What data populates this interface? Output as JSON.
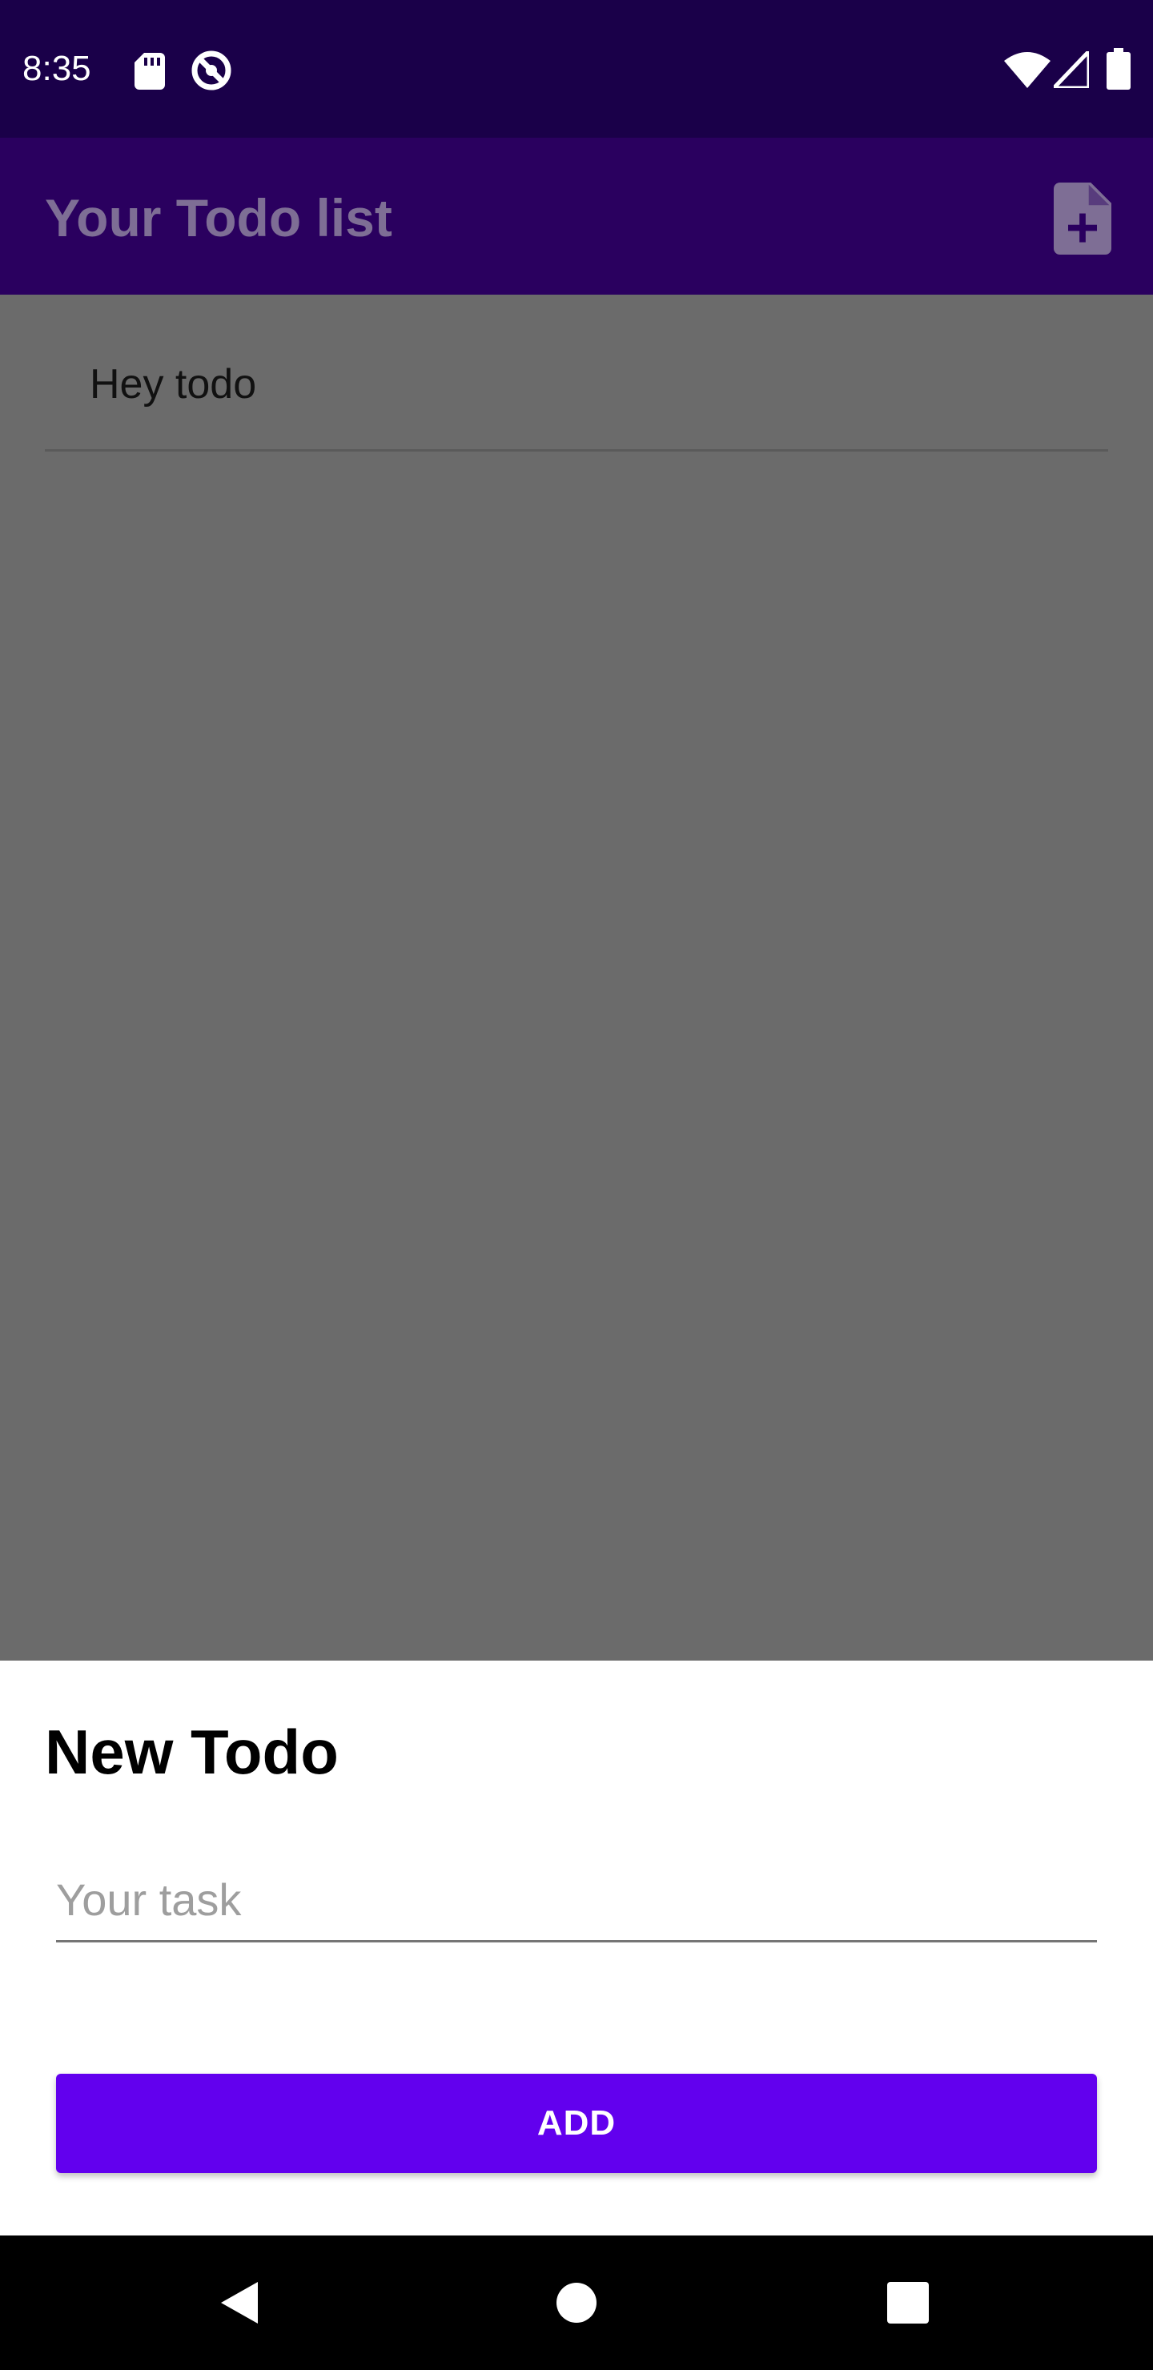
{
  "status_bar": {
    "time": "8:35",
    "icons": [
      "sd-card-icon",
      "do-not-disturb-icon",
      "wifi-icon",
      "signal-icon",
      "battery-icon"
    ]
  },
  "app_bar": {
    "title": "Your Todo list",
    "action_icon": "note-add-icon"
  },
  "todo_list": {
    "items": [
      {
        "label": "Hey todo"
      }
    ]
  },
  "sheet": {
    "title": "New Todo",
    "input_placeholder": "Your task",
    "input_value": "",
    "add_label": "ADD"
  },
  "nav_bar": {
    "buttons": [
      "back-icon",
      "home-icon",
      "recents-icon"
    ]
  },
  "colors": {
    "status_bar": "#1a0049",
    "app_bar": "#2a005f",
    "scrim": "#6b6b6b",
    "accent": "#6200ee"
  }
}
